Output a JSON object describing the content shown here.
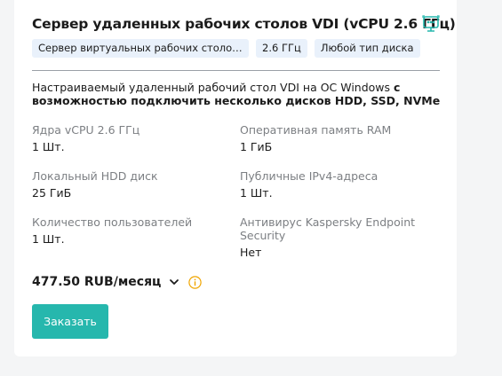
{
  "product": {
    "title": "Сервер удаленных рабочих столов VDI (vCPU 2.6 ГГц)",
    "icon": "vdi-remote-desktop-icon",
    "tags": [
      "Сервер виртуальных рабочих столов VDI",
      "2.6 ГГц",
      "Любой тип диска"
    ],
    "description_regular": "Настраиваемый удаленный рабочий стол VDI на ОС Windows ",
    "description_bold": "с возможностью подключить несколько дисков HDD, SSD, NVMe"
  },
  "specs": [
    {
      "label": "Ядра vCPU 2.6 ГГц",
      "value": "1 Шт."
    },
    {
      "label": "Оперативная память RAM",
      "value": "1 ГиБ"
    },
    {
      "label": "Локальный HDD диск",
      "value": "25 ГиБ"
    },
    {
      "label": "Публичные IPv4-адреса",
      "value": "1 Шт."
    },
    {
      "label": "Количество пользователей",
      "value": "1 Шт."
    },
    {
      "label": "Антивирус Kaspersky Endpoint Security",
      "value": "Нет"
    }
  ],
  "price": {
    "text": "477.50 RUB/месяц"
  },
  "actions": {
    "order_label": "Заказать"
  },
  "colors": {
    "accent": "#26b7ad",
    "info": "#f0a500",
    "tag_bg": "#e9f1fb"
  }
}
